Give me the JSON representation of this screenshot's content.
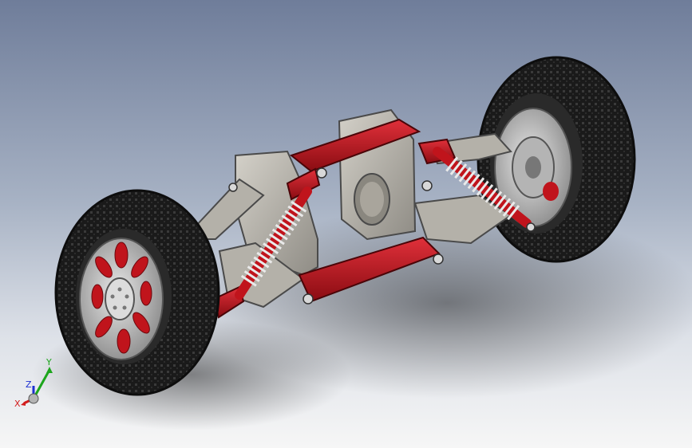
{
  "viewport": {
    "background_top": "#6f7d9a",
    "background_bottom": "#f6f6f6",
    "model": {
      "subject": "suspension-assembly",
      "accent_color": "#c0141c",
      "frame_color": "#b9b6ad",
      "tire_color": "#1c1c1c",
      "spring_color": "#e6e6e6"
    }
  },
  "triad": {
    "x_label": "X",
    "y_label": "Y",
    "z_label": "Z",
    "x_color": "#d21c1c",
    "y_color": "#1ca51c",
    "z_color": "#1c2fd2"
  }
}
